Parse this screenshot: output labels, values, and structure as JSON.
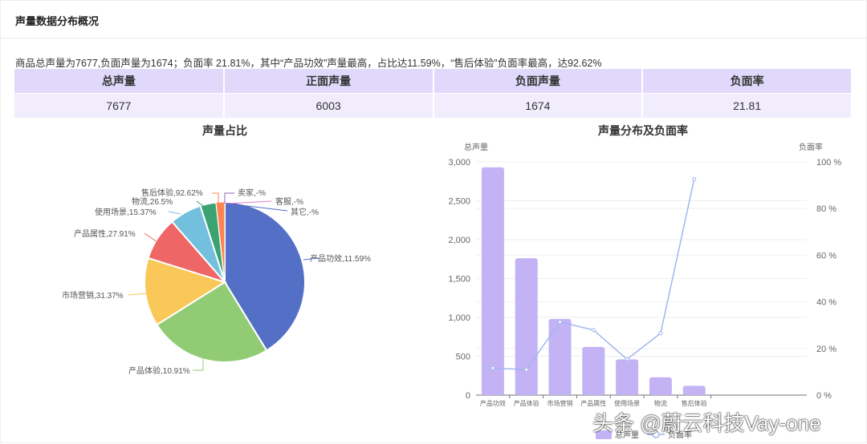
{
  "header": {
    "title": "声量数据分布概况"
  },
  "summary": "商品总声量为7677,负面声量为1674；负面率 21.81%，其中“产品功效”声量最高，占比达11.59%，“售后体验”负面率最高，达92.62%",
  "table": {
    "headers": [
      "总声量",
      "正面声量",
      "负面声量",
      "负面率"
    ],
    "values": [
      "7677",
      "6003",
      "1674",
      "21.81"
    ]
  },
  "watermark": "头条 @蔚云科技Vay-one",
  "chart_data": [
    {
      "type": "pie",
      "title": "声量占比",
      "categories": [
        "产品功效",
        "产品体验",
        "市场营销",
        "产品属性",
        "使用场景",
        "物流",
        "售后体验",
        "卖家",
        "客服",
        "其它"
      ],
      "values": [
        2930,
        1760,
        980,
        620,
        460,
        230,
        120,
        0,
        0,
        0
      ],
      "labels": [
        "产品功效,11.59%",
        "产品体验,10.91%",
        "市场营销,31.37%",
        "产品属性,27.91%",
        "使用场景,15.37%",
        "物流,26.5%",
        "售后体验,92.62%",
        "卖家,-%",
        "客服,-%",
        "其它,-%"
      ],
      "colors": [
        "#5470c6",
        "#91cc75",
        "#fac858",
        "#ee6666",
        "#73c0de",
        "#3ba272",
        "#fc8452",
        "#9a60b4",
        "#ea7ccc",
        "#5470c6"
      ]
    },
    {
      "type": "bar+line",
      "title": "声量分布及负面率",
      "ylabel": "总声量",
      "y2label": "负面率",
      "categories": [
        "产品功效",
        "产品体验",
        "市场营销",
        "产品属性",
        "使用场景",
        "物流",
        "售后体验"
      ],
      "series": [
        {
          "name": "总声量",
          "type": "bar",
          "values": [
            2930,
            1760,
            980,
            620,
            460,
            230,
            120
          ],
          "color": "#c3b3f5"
        },
        {
          "name": "负面率",
          "type": "line",
          "values": [
            11.59,
            10.91,
            31.37,
            27.91,
            15.37,
            26.5,
            92.62
          ],
          "color": "#a3b6ee"
        }
      ],
      "ylim": [
        0,
        3000
      ],
      "yticks": [
        "0",
        "500",
        "1,000",
        "1,500",
        "2,000",
        "2,500",
        "3,000"
      ],
      "y2lim": [
        0,
        100
      ],
      "y2ticks": [
        "0 %",
        "20 %",
        "40 %",
        "60 %",
        "80 %",
        "100 %"
      ],
      "legend": "bottom"
    }
  ]
}
